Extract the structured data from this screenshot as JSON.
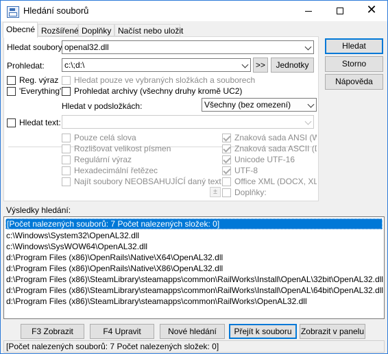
{
  "window": {
    "title": "Hledání souborů",
    "minimize": "—",
    "maximize": "",
    "close": "✕"
  },
  "tabs": [
    "Obecné",
    "Rozšířené",
    "Doplňky",
    "Načíst nebo uložit"
  ],
  "search": {
    "files_label": "Hledat soubory:",
    "files_value": "openal32.dll",
    "location_label": "Prohledat:",
    "location_value": "c:\\;d:\\",
    "browse_label": ">>",
    "drives_label": "Jednotky"
  },
  "options": {
    "regex_label": "Reg. výraz",
    "everything_label": "'Everything'",
    "selected_only_label": "Hledat pouze ve vybraných složkách a souborech",
    "archives_label": "Prohledat archivy (všechny druhy kromě UC2)",
    "subfolders_label": "Hledat v podsložkách:",
    "subfolders_value": "Všechny (bez omezení)"
  },
  "text_search": {
    "label": "Hledat text:",
    "value": "",
    "left_options": [
      "Pouze celá slova",
      "Rozlišovat velikost písmen",
      "Regulární výraz",
      "Hexadecimální řetězec",
      "Najít soubory NEOBSAHUJÍCÍ daný text"
    ],
    "right_options": [
      {
        "label": "Znaková sada ANSI (Wind",
        "checked": true
      },
      {
        "label": "Znaková sada ASCII (DOS",
        "checked": true
      },
      {
        "label": "Unicode UTF-16",
        "checked": true
      },
      {
        "label": "UTF-8",
        "checked": true
      },
      {
        "label": "Office XML (DOCX, XLSX",
        "checked": false
      },
      {
        "label": "Doplňky:",
        "checked": false
      }
    ],
    "plus": "±"
  },
  "side_buttons": {
    "search": "Hledat",
    "cancel": "Storno",
    "help": "Nápověda"
  },
  "results": {
    "label": "Výsledky hledání:",
    "rows": [
      "[Počet nalezených souborů: 7   Počet nalezených složek: 0]",
      "c:\\Windows\\System32\\OpenAL32.dll",
      "c:\\Windows\\SysWOW64\\OpenAL32.dll",
      "d:\\Program Files (x86)\\OpenRails\\Native\\X64\\OpenAL32.dll",
      "d:\\Program Files (x86)\\OpenRails\\Native\\X86\\OpenAL32.dll",
      "d:\\Program Files (x86)\\SteamLibrary\\steamapps\\common\\RailWorks\\Install\\OpenAL\\32bit\\OpenAL32.dll",
      "d:\\Program Files (x86)\\SteamLibrary\\steamapps\\common\\RailWorks\\Install\\OpenAL\\64bit\\OpenAL32.dll",
      "d:\\Program Files (x86)\\SteamLibrary\\steamapps\\common\\RailWorks\\OpenAL32.dll"
    ]
  },
  "bottom_buttons": [
    "F3 Zobrazit",
    "F4 Upravit",
    "Nové hledání",
    "Přejít k souboru",
    "Zobrazit v panelu"
  ],
  "status": "[Počet nalezených souborů: 7   Počet nalezených složek: 0]",
  "colors": {
    "selection": "#0078d7",
    "default_button_border": "#0078d7",
    "disabled_text": "#8c8c8c"
  }
}
